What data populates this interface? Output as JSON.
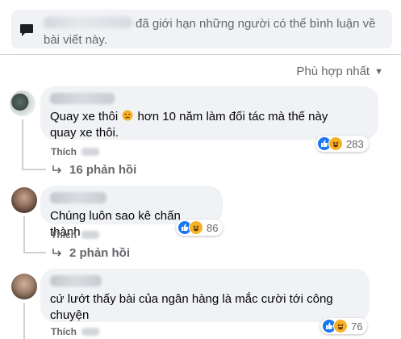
{
  "notice": {
    "text": "đã giới hạn những người có thể bình luận về bài viết này."
  },
  "sort": {
    "label": "Phù hợp nhất"
  },
  "comments": [
    {
      "text_line1": "Quay xe thôi",
      "text_line1_rest": " hơn 10 năm làm đối tác mà thế này",
      "text_line2": "quay xe thôi.",
      "action": "Thích",
      "reaction_count": "283",
      "replies": "16 phản hồi"
    },
    {
      "text": "Chúng luôn sao kê chấn thành",
      "action": "Thích",
      "reaction_count": "86",
      "replies": "2 phản hồi"
    },
    {
      "text_line1": "cứ lướt thấy bài của ngân hàng là mắc cười tới công",
      "text_line2": "chuyện",
      "action": "Thích",
      "reaction_count": "76"
    }
  ],
  "colors": {
    "like": "#1877f2",
    "haha": "#f7b125",
    "secondary_text": "#65676b",
    "bubble": "#f0f2f5"
  }
}
